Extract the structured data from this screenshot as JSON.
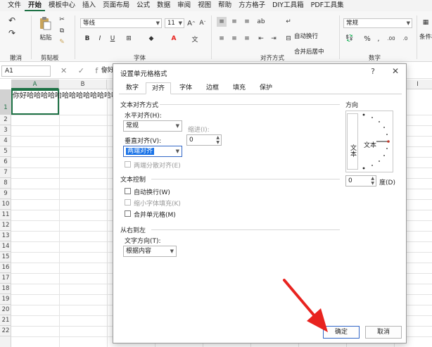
{
  "menubar": {
    "items": [
      "文件",
      "开始",
      "模板中心",
      "插入",
      "页面布局",
      "公式",
      "数据",
      "审阅",
      "视图",
      "帮助",
      "方方格子",
      "DIY工具箱",
      "PDF工具集"
    ],
    "active_index": 1
  },
  "ribbon": {
    "undo_group": "撤消",
    "clipboard_group": "剪贴板",
    "paste_label": "粘贴",
    "font_group": "字体",
    "font_name": "等线",
    "font_size": "11",
    "bold": "B",
    "italic": "I",
    "underline": "U",
    "align_group": "对齐方式",
    "wrap_text": "自动换行",
    "merge_center": "合并后居中",
    "number_group": "数字",
    "number_format": "常规",
    "conditional_format": "条件格"
  },
  "formulabar": {
    "cell_ref": "A1",
    "icons": "✕ ✓ fx",
    "content": "你好"
  },
  "grid": {
    "columns": [
      "A",
      "B",
      "C",
      "D",
      "E",
      "F",
      "G",
      "H",
      "I"
    ],
    "rows": [
      "1",
      "2",
      "3",
      "4",
      "5",
      "6",
      "7",
      "8",
      "9",
      "10",
      "11",
      "12",
      "13",
      "14",
      "15",
      "16",
      "17",
      "18",
      "19",
      "20",
      "21",
      "22"
    ],
    "a1_value": "你好哈哈哈哈哈哈哈哈哈哈哈哈哈"
  },
  "dialog": {
    "title": "设置单元格格式",
    "help": "?",
    "close": "✕",
    "tabs": [
      "数字",
      "对齐",
      "字体",
      "边框",
      "填充",
      "保护"
    ],
    "active_tab": 1,
    "text_alignment_section": "文本对齐方式",
    "horizontal_label": "水平对齐(H):",
    "horizontal_value": "常规",
    "indent_label": "缩进(I):",
    "indent_value": "0",
    "vertical_label": "垂直对齐(V):",
    "vertical_value": "两端对齐",
    "justify_distributed": "两端分散对齐(E)",
    "text_control_section": "文本控制",
    "wrap_text": "自动换行(W)",
    "shrink_to_fit": "缩小字体填充(K)",
    "merge_cells": "合并单元格(M)",
    "rtl_section": "从右到左",
    "text_direction_label": "文字方向(T):",
    "text_direction_value": "根据内容",
    "orientation_section": "方向",
    "orientation_vertical_text": "文本",
    "orientation_text": "文本",
    "degree_value": "0",
    "degree_label": "度(D)",
    "ok": "确定",
    "cancel": "取消"
  },
  "colors": {
    "accent_green": "#1e7145",
    "selection_blue": "#1a73e8",
    "annotation_red": "#e8231f"
  }
}
